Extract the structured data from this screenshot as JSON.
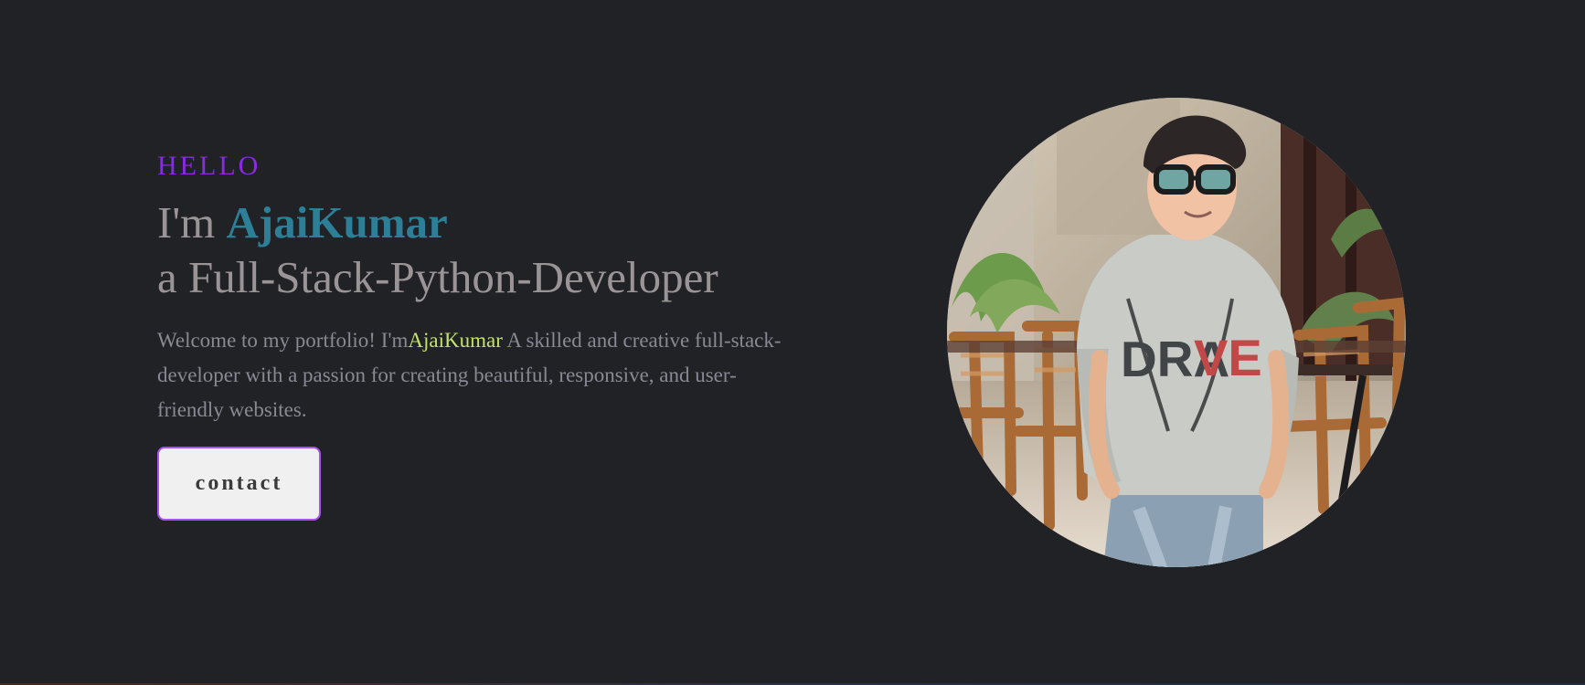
{
  "hero": {
    "greeting": "HELLO",
    "heading_prefix": "I'm ",
    "name": "AjaiKumar",
    "role": "a Full-Stack-Python-Developer",
    "description": {
      "before_name": "Welcome to my portfolio! I'm",
      "name": "AjaiKumar",
      "after_name": " A skilled and creative full-stack-developer with a passion for creating beautiful, responsive, and user-friendly websites."
    },
    "contact_label": "contact"
  },
  "colors": {
    "background": "#202226",
    "greeting": "#8a2be2",
    "heading": "#9a9497",
    "name": "#2c7f97",
    "description": "#878a93",
    "description_name": "#c5e26c",
    "button_border": "#a84ff5",
    "button_background": "#f0f0f0"
  }
}
